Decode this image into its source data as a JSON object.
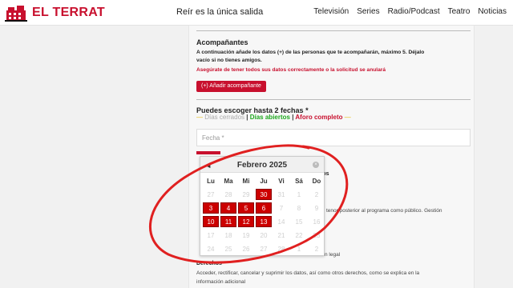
{
  "header": {
    "logo_text": "EL TERRAT",
    "tagline": "Reír es la única salida",
    "nav": [
      "Televisión",
      "Series",
      "Radio/Podcast",
      "Teatro",
      "Noticias"
    ]
  },
  "companions": {
    "title": "Acompañantes",
    "desc_1": "A continuación añade los datos (+) de las personas que te acompañarán, máximo 5. Déjalo",
    "desc_2": "vacío si no tienes amigos.",
    "warning": "Asegúrate de tener todos sus datos correctamente o la solicitud se anulará",
    "add_button": "(+) Añadir acompañante"
  },
  "dates": {
    "title": "Puedes escoger hasta 2 fechas *",
    "legend_closed": "Días cerrados",
    "legend_open": "Días abiertos",
    "legend_full": "Aforo completo",
    "date_placeholder": "Fecha *"
  },
  "background_text": {
    "frag_1": "tos",
    "frag_2": "tenor posterior al programa como público. Gestión",
    "frag_3": "n legal",
    "rights_title": "Derechos",
    "rights_line_1": "Acceder, rectificar, cancelar y suprimir los datos, así como otros derechos, como se explica en la",
    "rights_line_2": "información adicional"
  },
  "datepicker": {
    "prev_icon": "◀",
    "next_icon": "×",
    "month_title": "Febrero 2025",
    "weekdays": [
      "Lu",
      "Ma",
      "Mi",
      "Ju",
      "Vi",
      "Sá",
      "Do"
    ],
    "weeks": [
      [
        {
          "d": "27",
          "s": "other"
        },
        {
          "d": "28",
          "s": "other"
        },
        {
          "d": "29",
          "s": "other"
        },
        {
          "d": "30",
          "s": "sel"
        },
        {
          "d": "31",
          "s": "other"
        },
        {
          "d": "1",
          "s": "closed"
        },
        {
          "d": "2",
          "s": "closed"
        }
      ],
      [
        {
          "d": "3",
          "s": "sel"
        },
        {
          "d": "4",
          "s": "sel"
        },
        {
          "d": "5",
          "s": "sel"
        },
        {
          "d": "6",
          "s": "sel"
        },
        {
          "d": "7",
          "s": "closed"
        },
        {
          "d": "8",
          "s": "closed"
        },
        {
          "d": "9",
          "s": "closed"
        }
      ],
      [
        {
          "d": "10",
          "s": "sel"
        },
        {
          "d": "11",
          "s": "sel"
        },
        {
          "d": "12",
          "s": "sel"
        },
        {
          "d": "13",
          "s": "sel"
        },
        {
          "d": "14",
          "s": "closed"
        },
        {
          "d": "15",
          "s": "closed"
        },
        {
          "d": "16",
          "s": "closed"
        }
      ],
      [
        {
          "d": "17",
          "s": "closed"
        },
        {
          "d": "18",
          "s": "closed"
        },
        {
          "d": "19",
          "s": "closed"
        },
        {
          "d": "20",
          "s": "closed"
        },
        {
          "d": "21",
          "s": "closed"
        },
        {
          "d": "22",
          "s": "closed"
        },
        {
          "d": "23",
          "s": "closed"
        }
      ],
      [
        {
          "d": "24",
          "s": "closed"
        },
        {
          "d": "25",
          "s": "closed"
        },
        {
          "d": "26",
          "s": "closed"
        },
        {
          "d": "27",
          "s": "closed"
        },
        {
          "d": "28",
          "s": "closed"
        },
        {
          "d": "1",
          "s": "other"
        },
        {
          "d": "2",
          "s": "other"
        }
      ]
    ]
  },
  "colors": {
    "brand_red": "#c8102e",
    "open_green": "#1ea81e",
    "selected_day": "#cc0000",
    "annotation_circle": "#e02020"
  }
}
